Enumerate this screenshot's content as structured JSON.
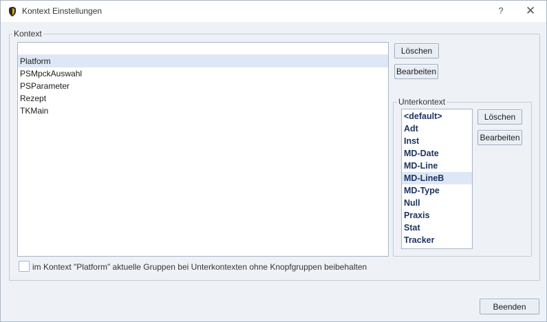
{
  "window": {
    "title": "Kontext Einstellungen",
    "help_label": "?",
    "close_label": "✕"
  },
  "context_group": {
    "label": "Kontext",
    "filter_value": "",
    "items": [
      "Platform",
      "PSMpckAuswahl",
      "PSParameter",
      "Rezept",
      "TKMain"
    ],
    "selected": "Platform",
    "delete_label": "Löschen",
    "edit_label": "Bearbeiten"
  },
  "subcontext_group": {
    "label": "Unterkontext",
    "items": [
      "<default>",
      "Adt",
      "Inst",
      "MD-Date",
      "MD-Line",
      "MD-LineB",
      "MD-Type",
      "Null",
      "Praxis",
      "Stat",
      "Tracker"
    ],
    "selected": "MD-LineB",
    "delete_label": "Löschen",
    "edit_label": "Bearbeiten"
  },
  "keep_groups_checkbox": {
    "label": "im Kontext \"Platform\" aktuelle Gruppen bei Unterkontexten ohne Knopfgruppen beibehalten",
    "checked": false
  },
  "finish_label": "Beenden"
}
